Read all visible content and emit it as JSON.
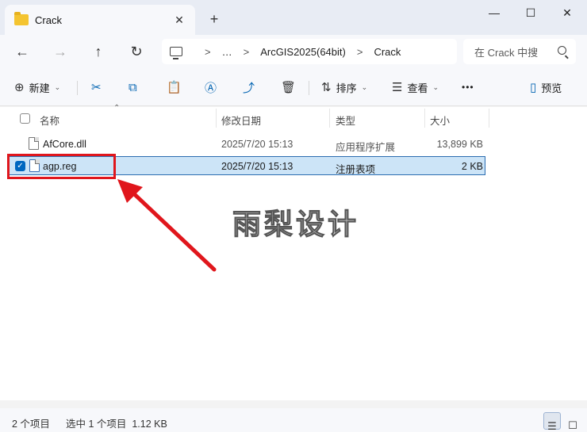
{
  "window": {
    "tab_title": "Crack",
    "close_tab_glyph": "✕",
    "new_tab_glyph": "+",
    "minimize_glyph": "—",
    "maximize_glyph": "☐",
    "close_glyph": "✕"
  },
  "nav": {
    "back_glyph": "←",
    "forward_glyph": "→",
    "up_glyph": "↑",
    "refresh_glyph": "↻",
    "breadcrumb": [
      "…",
      "ArcGIS2025(64bit)",
      "Crack"
    ],
    "separator": ">",
    "search_placeholder": "在 Crack 中搜"
  },
  "toolbar": {
    "new_label": "新建",
    "new_icon": "⊕",
    "cut_icon": "✂",
    "copy_icon": "⧉",
    "paste_icon": "📋",
    "rename_icon": "Ⓐ",
    "share_icon": "⤴",
    "delete_icon": "🗑",
    "sort_label": "排序",
    "sort_icon": "⇅",
    "view_label": "查看",
    "view_icon": "☰",
    "more_icon": "•••",
    "preview_label": "预览",
    "preview_icon": "▯",
    "chevron": "⌄"
  },
  "columns": {
    "name": "名称",
    "modified": "修改日期",
    "type": "类型",
    "size": "大小",
    "sort_indicator": "⌃"
  },
  "files": [
    {
      "name": "AfCore.dll",
      "modified": "2025/7/20 15:13",
      "type": "应用程序扩展",
      "size": "13,899 KB",
      "selected": false
    },
    {
      "name": "agp.reg",
      "modified": "2025/7/20 15:13",
      "type": "注册表项",
      "size": "2 KB",
      "selected": true
    }
  ],
  "watermark": "雨梨设计",
  "status": {
    "item_count": "2 个项目",
    "selection": "选中 1 个项目  1.12 KB",
    "details_view_icon": "☰",
    "tiles_view_icon": "☐"
  },
  "colors": {
    "accent": "#0067c0",
    "selection_bg": "#cce4f7",
    "annotation_red": "#e0161c"
  }
}
